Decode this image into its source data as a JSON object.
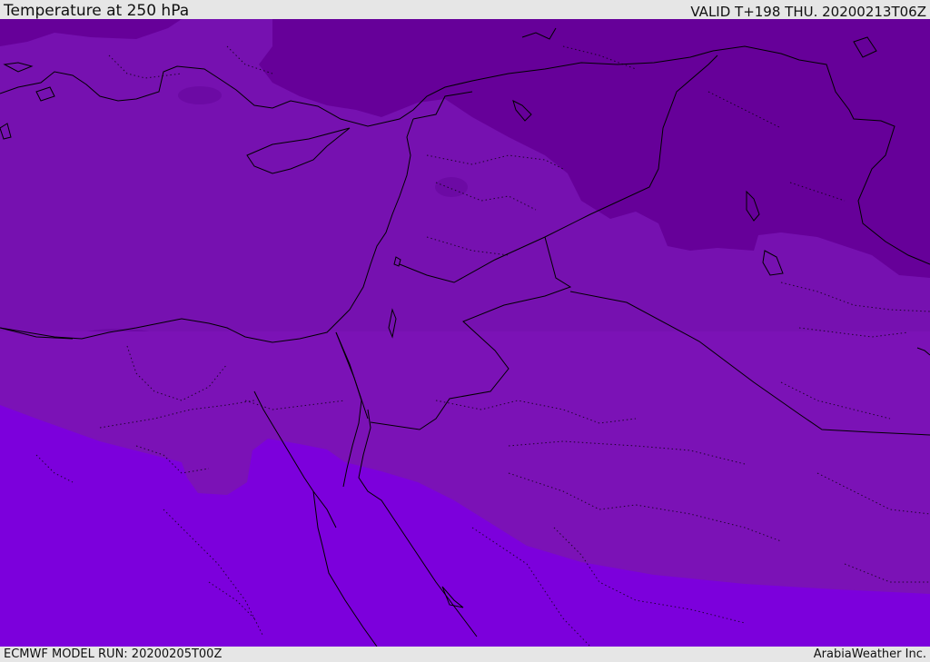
{
  "header": {
    "title": "Temperature at 250 hPa",
    "valid_time": "VALID T+198 THU. 20200213T06Z"
  },
  "footer": {
    "model_run": "ECMWF MODEL RUN: 20200205T00Z",
    "credit": "ArabiaWeather Inc."
  },
  "map": {
    "variable": "Temperature",
    "level": "250 hPa",
    "shading_colors": {
      "coldest": "#660099",
      "cold": "#7513ad",
      "mid": "#7b11b9",
      "warm": "#7c00dc"
    },
    "boundary_color": "#000000"
  }
}
